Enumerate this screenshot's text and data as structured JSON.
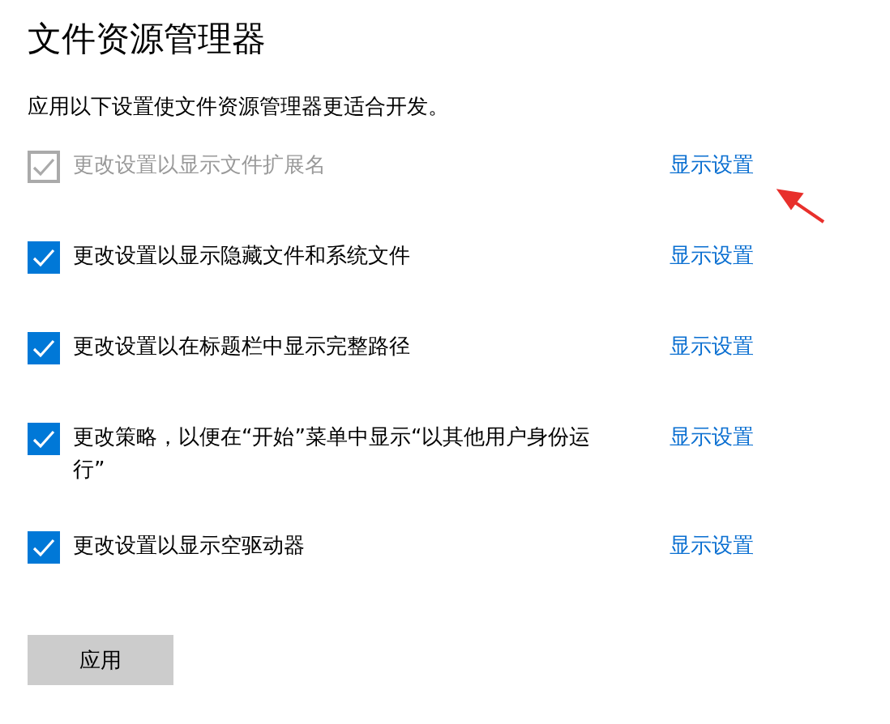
{
  "title": "文件资源管理器",
  "description": "应用以下设置使文件资源管理器更适合开发。",
  "settings": [
    {
      "label": "更改设置以显示文件扩展名",
      "checked": true,
      "disabled": true,
      "link": "显示设置",
      "annotated": true
    },
    {
      "label": "更改设置以显示隐藏文件和系统文件",
      "checked": true,
      "disabled": false,
      "link": "显示设置",
      "annotated": false
    },
    {
      "label": "更改设置以在标题栏中显示完整路径",
      "checked": true,
      "disabled": false,
      "link": "显示设置",
      "annotated": false
    },
    {
      "label": "更改策略，以便在“开始”菜单中显示“以其他用户身份运行”",
      "checked": true,
      "disabled": false,
      "link": "显示设置",
      "annotated": false
    },
    {
      "label": "更改设置以显示空驱动器",
      "checked": true,
      "disabled": false,
      "link": "显示设置",
      "annotated": false
    }
  ],
  "apply_button": "应用"
}
